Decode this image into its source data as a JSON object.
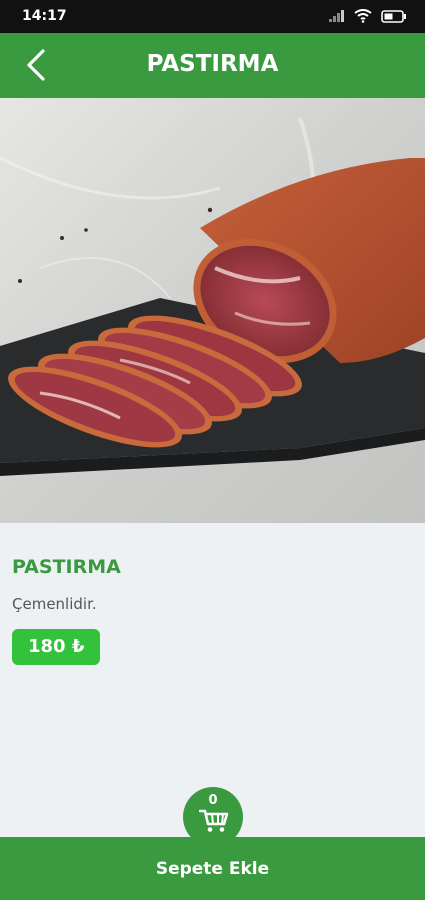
{
  "status_bar": {
    "time": "14:17",
    "icons": [
      "signal-icon",
      "wifi-icon",
      "battery-icon"
    ]
  },
  "header": {
    "title": "PASTIRMA",
    "back_icon": "chevron-left-icon"
  },
  "product": {
    "name": "PASTIRMA",
    "description": "Çemenlidir.",
    "price": "180 ₺"
  },
  "cart": {
    "count": "0",
    "icon": "cart-icon",
    "button_label": "Sepete Ekle"
  },
  "colors": {
    "primary_green": "#3a9a3f",
    "price_green": "#33c33a",
    "background": "#eef1f4"
  }
}
